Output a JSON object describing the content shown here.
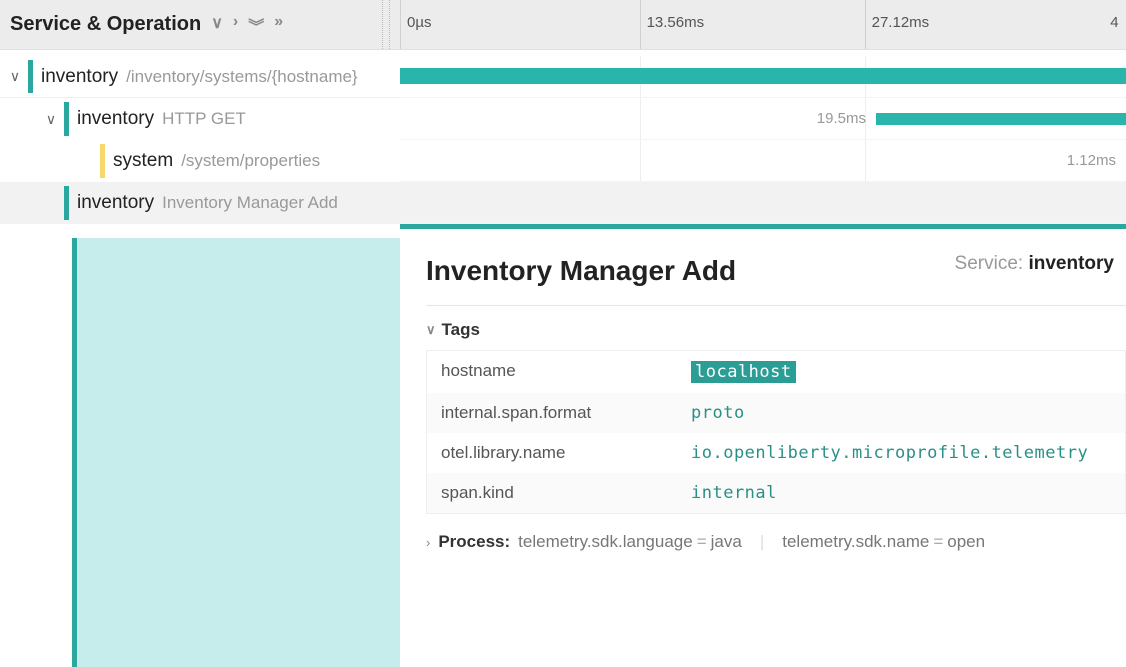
{
  "header": {
    "title": "Service & Operation"
  },
  "timeline": {
    "ticks": [
      "0µs",
      "13.56ms",
      "27.12ms",
      "4"
    ],
    "lanes": [
      {
        "label": ""
      },
      {
        "label": "19.5ms"
      },
      {
        "label": "1.12ms"
      },
      {
        "label": ""
      }
    ]
  },
  "tree": [
    {
      "svc": "inventory",
      "op": "/inventory/systems/{hostname}"
    },
    {
      "svc": "inventory",
      "op": "HTTP GET"
    },
    {
      "svc": "system",
      "op": "/system/properties"
    },
    {
      "svc": "inventory",
      "op": "Inventory Manager Add"
    }
  ],
  "detail": {
    "title": "Inventory Manager Add",
    "service_label": "Service:",
    "service_name": "inventory",
    "tags_header": "Tags",
    "tags": [
      {
        "key": "hostname",
        "val": "localhost",
        "hilite": true
      },
      {
        "key": "internal.span.format",
        "val": "proto"
      },
      {
        "key": "otel.library.name",
        "val": "io.openliberty.microprofile.telemetry"
      },
      {
        "key": "span.kind",
        "val": "internal"
      }
    ],
    "process": {
      "label": "Process:",
      "kv": [
        {
          "k": "telemetry.sdk.language",
          "v": "java"
        },
        {
          "k": "telemetry.sdk.name",
          "v": "open"
        }
      ]
    }
  }
}
